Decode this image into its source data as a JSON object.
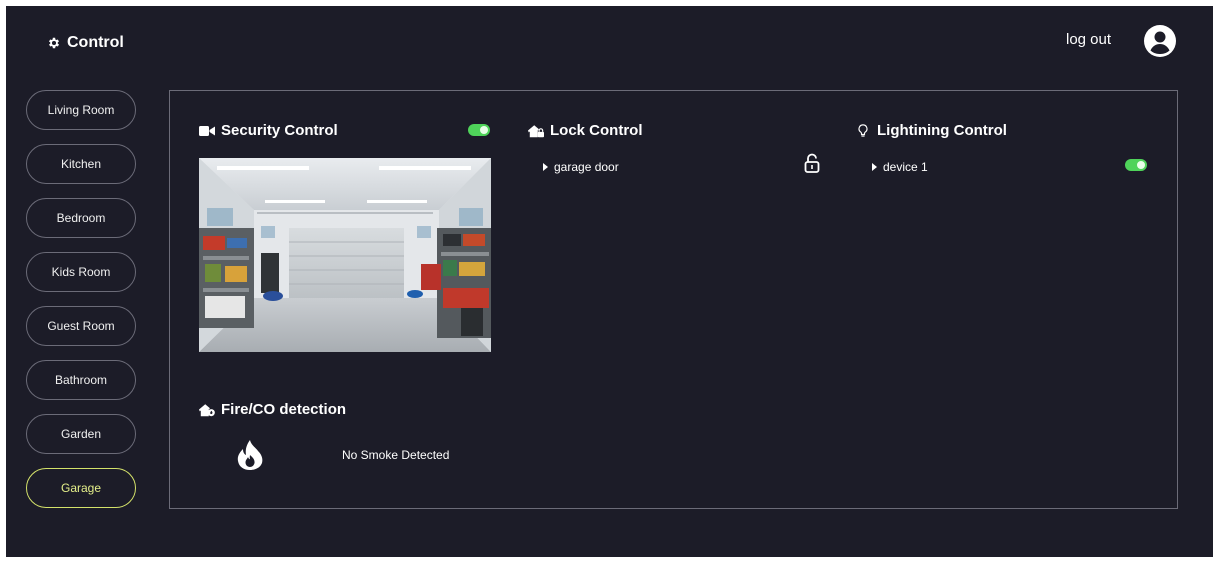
{
  "header": {
    "brand": "Control",
    "logout": "log out"
  },
  "sidebar": {
    "rooms": [
      {
        "label": "Living Room",
        "active": false
      },
      {
        "label": "Kitchen",
        "active": false
      },
      {
        "label": "Bedroom",
        "active": false
      },
      {
        "label": "Kids Room",
        "active": false
      },
      {
        "label": "Guest Room",
        "active": false
      },
      {
        "label": "Bathroom",
        "active": false
      },
      {
        "label": "Garden",
        "active": false
      },
      {
        "label": "Garage",
        "active": true
      }
    ]
  },
  "security": {
    "title": "Security Control",
    "enabled": true
  },
  "lock": {
    "title": "Lock Control",
    "devices": [
      {
        "label": "garage door",
        "state": "unlocked"
      }
    ]
  },
  "lighting": {
    "title": "Lightining Control",
    "devices": [
      {
        "label": "device 1",
        "on": true
      }
    ]
  },
  "fire": {
    "title": "Fire/CO detection",
    "status": "No Smoke Detected"
  },
  "colors": {
    "background": "#1c1c28",
    "active_accent": "#d4e26a",
    "toggle_on": "#4fd35a",
    "border": "#6b6b78"
  },
  "icons": {
    "brand": "gear-icon",
    "avatar": "user-circle-icon",
    "security": "video-camera-icon",
    "lock": "house-lock-icon",
    "lighting": "lightbulb-icon",
    "lock_state": "padlock-icon",
    "fire_title": "house-fire-icon",
    "fire_status": "flame-icon"
  }
}
